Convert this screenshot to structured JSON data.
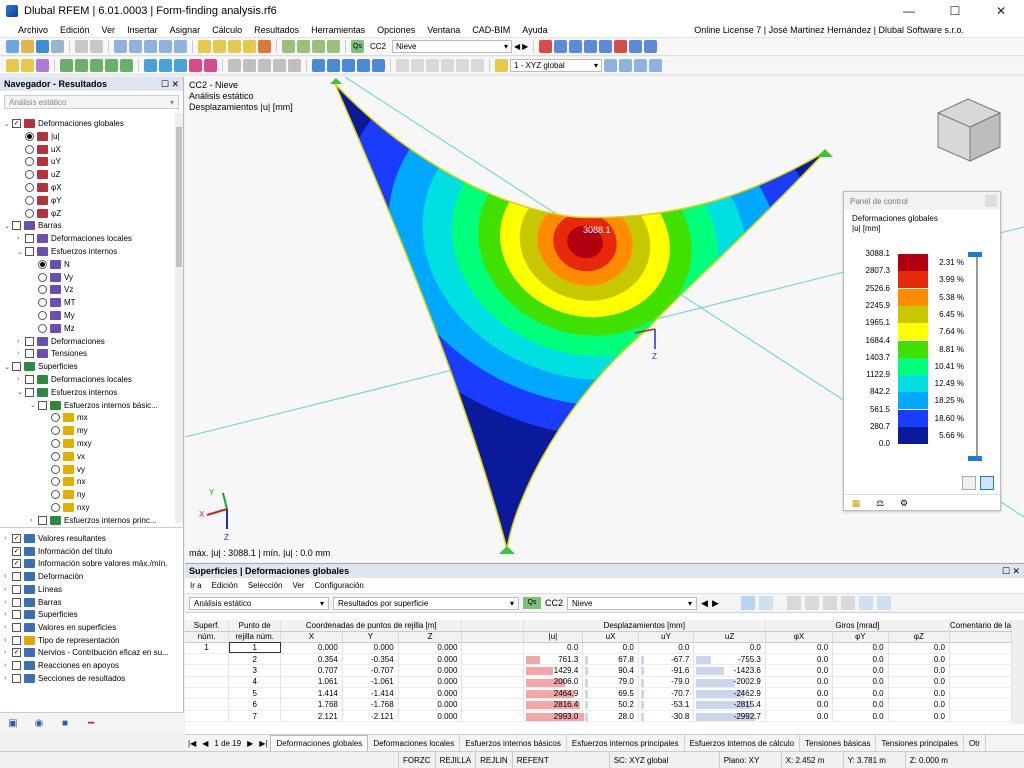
{
  "window": {
    "title": "Dlubal RFEM | 6.01.0003 | Form-finding analysis.rf6"
  },
  "menu": {
    "items": [
      "Archivo",
      "Edición",
      "Ver",
      "Insertar",
      "Asignar",
      "Cálculo",
      "Resultados",
      "Herramientas",
      "Opciones",
      "Ventana",
      "CAD-BIM",
      "Ayuda"
    ],
    "license": "Online License 7 | José Martinez Hernández | Dlubal Software s.r.o."
  },
  "toolbar": {
    "loadcase_badge": "Qs",
    "loadcase_id": "CC2",
    "loadcase_name": "Nieve",
    "coord_system": "1 - XYZ global"
  },
  "navigator": {
    "title": "Navegador - Resultados",
    "combo": "Análisis estático",
    "tree": [
      {
        "label": "Deformaciones globales",
        "level": 0,
        "ctl": "cb",
        "checked": true,
        "exp": "v",
        "icon": "#b5323a"
      },
      {
        "label": "|u|",
        "level": 1,
        "ctl": "rb",
        "checked": true,
        "icon": "#b5323a"
      },
      {
        "label": "uX",
        "level": 1,
        "ctl": "rb",
        "icon": "#b5323a"
      },
      {
        "label": "uY",
        "level": 1,
        "ctl": "rb",
        "icon": "#b5323a"
      },
      {
        "label": "uZ",
        "level": 1,
        "ctl": "rb",
        "icon": "#b5323a"
      },
      {
        "label": "φX",
        "level": 1,
        "ctl": "rb",
        "icon": "#b5323a"
      },
      {
        "label": "φY",
        "level": 1,
        "ctl": "rb",
        "icon": "#b5323a"
      },
      {
        "label": "φZ",
        "level": 1,
        "ctl": "rb",
        "icon": "#b5323a"
      },
      {
        "label": "Barras",
        "level": 0,
        "ctl": "cb",
        "exp": "v",
        "icon": "#6a4fb0"
      },
      {
        "label": "Deformaciones locales",
        "level": 1,
        "ctl": "cb",
        "exp": ">",
        "icon": "#6a4fb0"
      },
      {
        "label": "Esfuerzos internos",
        "level": 1,
        "ctl": "cb",
        "exp": "v",
        "icon": "#6a4fb0"
      },
      {
        "label": "N",
        "level": 2,
        "ctl": "rb",
        "checked": true,
        "icon": "#6a4fb0"
      },
      {
        "label": "Vy",
        "level": 2,
        "ctl": "rb",
        "icon": "#6a4fb0"
      },
      {
        "label": "Vz",
        "level": 2,
        "ctl": "rb",
        "icon": "#6a4fb0"
      },
      {
        "label": "MT",
        "level": 2,
        "ctl": "rb",
        "icon": "#6a4fb0"
      },
      {
        "label": "My",
        "level": 2,
        "ctl": "rb",
        "icon": "#6a4fb0"
      },
      {
        "label": "Mz",
        "level": 2,
        "ctl": "rb",
        "icon": "#6a4fb0"
      },
      {
        "label": "Deformaciones",
        "level": 1,
        "ctl": "cb",
        "exp": ">",
        "icon": "#6a4fb0"
      },
      {
        "label": "Tensiones",
        "level": 1,
        "ctl": "cb",
        "exp": ">",
        "icon": "#6a4fb0"
      },
      {
        "label": "Superficies",
        "level": 0,
        "ctl": "cb",
        "exp": "v",
        "icon": "#2b8a3e"
      },
      {
        "label": "Deformaciones locales",
        "level": 1,
        "ctl": "cb",
        "exp": ">",
        "icon": "#2b8a3e"
      },
      {
        "label": "Esfuerzos internos",
        "level": 1,
        "ctl": "cb",
        "exp": "v",
        "icon": "#2b8a3e"
      },
      {
        "label": "Esfuerzos internos básic...",
        "level": 2,
        "ctl": "cb",
        "exp": "v",
        "icon": "#2b8a3e"
      },
      {
        "label": "mx",
        "level": 3,
        "ctl": "rb",
        "icon": "#e0b000"
      },
      {
        "label": "my",
        "level": 3,
        "ctl": "rb",
        "icon": "#e0b000"
      },
      {
        "label": "mxy",
        "level": 3,
        "ctl": "rb",
        "icon": "#e0b000"
      },
      {
        "label": "vx",
        "level": 3,
        "ctl": "rb",
        "icon": "#e0b000"
      },
      {
        "label": "vy",
        "level": 3,
        "ctl": "rb",
        "icon": "#e0b000"
      },
      {
        "label": "nx",
        "level": 3,
        "ctl": "rb",
        "icon": "#e0b000"
      },
      {
        "label": "ny",
        "level": 3,
        "ctl": "rb",
        "icon": "#e0b000"
      },
      {
        "label": "nxy",
        "level": 3,
        "ctl": "rb",
        "icon": "#e0b000"
      },
      {
        "label": "Esfuerzos internos princ...",
        "level": 2,
        "ctl": "cb",
        "exp": ">",
        "icon": "#2b8a3e"
      }
    ],
    "tree2": [
      {
        "label": "Valores resultantes",
        "checked": true,
        "exp": ">",
        "icon": "#3a6fb8"
      },
      {
        "label": "Información del título",
        "checked": true,
        "icon": "#3a6fb8"
      },
      {
        "label": "Información sobre valores máx./mín.",
        "checked": true,
        "icon": "#3a6fb8"
      },
      {
        "label": "Deformación",
        "exp": ">",
        "icon": "#3a6fb8"
      },
      {
        "label": "Líneas",
        "exp": ">",
        "icon": "#3a6fb8"
      },
      {
        "label": "Barras",
        "exp": ">",
        "icon": "#3a6fb8"
      },
      {
        "label": "Superficies",
        "exp": ">",
        "icon": "#3a6fb8"
      },
      {
        "label": "Valores en superficies",
        "exp": ">",
        "icon": "#3a6fb8"
      },
      {
        "label": "Tipo de representación",
        "exp": ">",
        "icon": "#e0a800"
      },
      {
        "label": "Nervios - Contribución eficaz en su...",
        "checked": true,
        "exp": ">",
        "icon": "#3a6fb8"
      },
      {
        "label": "Reacciones en apoyos",
        "exp": ">",
        "icon": "#3a6fb8"
      },
      {
        "label": "Secciones de resultados",
        "exp": ">",
        "icon": "#3a6fb8"
      }
    ]
  },
  "viewport": {
    "info_lines": [
      "CC2 - Nieve",
      "Análisis estático",
      "Desplazamientos |u| [mm]"
    ],
    "summary": "máx. |u| : 3088.1 | mín. |u| : 0.0 mm",
    "max_label": "3088.1",
    "axes": {
      "x": "X",
      "y": "Y",
      "z": "Z"
    }
  },
  "control_panel": {
    "title": "Panel de control",
    "caption1": "Deformaciones globales",
    "caption2": "|u| [mm]",
    "legend": [
      {
        "value": "3088.1",
        "pct": "2.31 %",
        "color": "#b00010"
      },
      {
        "value": "2807.3",
        "pct": "3.99 %",
        "color": "#e8280a"
      },
      {
        "value": "2526.6",
        "pct": "5.38 %",
        "color": "#ff8c00"
      },
      {
        "value": "2245.9",
        "pct": "6.45 %",
        "color": "#c8c800"
      },
      {
        "value": "1965.1",
        "pct": "7.64 %",
        "color": "#ffff00"
      },
      {
        "value": "1684.4",
        "pct": "8.81 %",
        "color": "#40e000"
      },
      {
        "value": "1403.7",
        "pct": "10.41 %",
        "color": "#00ff7a"
      },
      {
        "value": "1122.9",
        "pct": "12.49 %",
        "color": "#00e0e0"
      },
      {
        "value": "842.2",
        "pct": "18.25 %",
        "color": "#00a8ff"
      },
      {
        "value": "561.5",
        "pct": "18.60 %",
        "color": "#1a3cff"
      },
      {
        "value": "280.7",
        "pct": "5.66 %",
        "color": "#0a1a9a"
      },
      {
        "value": "0.0",
        "pct": "",
        "color": ""
      }
    ]
  },
  "results": {
    "title": "Superficies | Deformaciones globales",
    "menu": [
      "Ir a",
      "Edición",
      "Selección",
      "Ver",
      "Configuración"
    ],
    "combo1": "Análisis estático",
    "combo2": "Resultados por superficie",
    "lc_badge": "Qs",
    "lc_id": "CC2",
    "lc_name": "Nieve",
    "groups": {
      "coords": "Coordenadas de puntos de rejilla [m]",
      "disp": "Desplazamientos [mm]",
      "rot": "Giros [mrad]"
    },
    "columns": {
      "surf": "Superf.",
      "surf2": "núm.",
      "pt": "Punto de",
      "pt2": "rejilla núm.",
      "x": "X",
      "y": "Y",
      "z": "Z",
      "u": "|u|",
      "ux": "uX",
      "uy": "uY",
      "uz": "uZ",
      "px": "φX",
      "py": "φY",
      "pz": "φZ",
      "comment": "Comentario de la"
    },
    "surface_no": "1",
    "rows": [
      {
        "pt": "1",
        "x": "0.000",
        "y": "0.000",
        "z": "0.000",
        "u": "0.0",
        "ux": "0.0",
        "uy": "0.0",
        "uz": "0.0",
        "px": "0.0",
        "py": "0.0",
        "pz": "0.0"
      },
      {
        "pt": "2",
        "x": "0.354",
        "y": "-0.354",
        "z": "0.000",
        "u": "761.3",
        "ux": "67.8",
        "uy": "-67.7",
        "uz": "-755.3",
        "px": "0.0",
        "py": "0.0",
        "pz": "0.0"
      },
      {
        "pt": "3",
        "x": "0.707",
        "y": "-0.707",
        "z": "0.000",
        "u": "1429.4",
        "ux": "90.4",
        "uy": "-91.6",
        "uz": "-1423.6",
        "px": "0.0",
        "py": "0.0",
        "pz": "0.0"
      },
      {
        "pt": "4",
        "x": "1.061",
        "y": "-1.061",
        "z": "0.000",
        "u": "2006.0",
        "ux": "79.0",
        "uy": "-79.0",
        "uz": "-2002.9",
        "px": "0.0",
        "py": "0.0",
        "pz": "0.0"
      },
      {
        "pt": "5",
        "x": "1.414",
        "y": "-1.414",
        "z": "0.000",
        "u": "2464.9",
        "ux": "69.5",
        "uy": "-70.7",
        "uz": "-2462.9",
        "px": "0.0",
        "py": "0.0",
        "pz": "0.0"
      },
      {
        "pt": "6",
        "x": "1.768",
        "y": "-1.768",
        "z": "0.000",
        "u": "2816.4",
        "ux": "50.2",
        "uy": "-53.1",
        "uz": "-2815.4",
        "px": "0.0",
        "py": "0.0",
        "pz": "0.0"
      },
      {
        "pt": "7",
        "x": "2.121",
        "y": "-2.121",
        "z": "0.000",
        "u": "2993.0",
        "ux": "28.0",
        "uy": "-30.8",
        "uz": "-2992.7",
        "px": "0.0",
        "py": "0.0",
        "pz": "0.0"
      }
    ],
    "page": "1 de 19",
    "tabs": [
      "Deformaciones globales",
      "Deformaciones locales",
      "Esfuerzos internos básicos",
      "Esfuerzos internos principales",
      "Esfuerzos internos de cálculo",
      "Tensiones básicas",
      "Tensiones principales",
      "Otr"
    ]
  },
  "status": {
    "toggles": [
      "FORZC",
      "REJILLA",
      "REJLIN",
      "REFENT"
    ],
    "sc": "SC: XYZ global",
    "plane": "Plano: XY",
    "x": "X: 2.452 m",
    "y": "Y: 3.781 m",
    "z": "Z: 0.000 m"
  }
}
